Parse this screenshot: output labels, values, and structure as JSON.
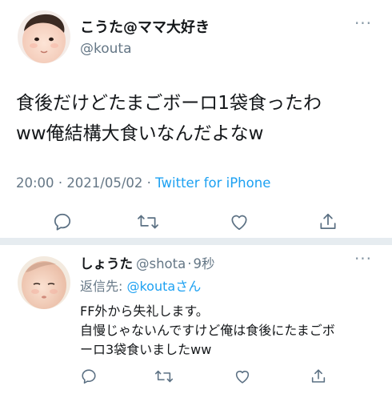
{
  "main_tweet": {
    "display_name": "こうた@ママ大好き",
    "handle": "@kouta",
    "body_lines": [
      "食後だけどたまごボーロ1袋食ったわ",
      "ww俺結構大食いなんだよなw"
    ],
    "time": "20:00",
    "separator": "·",
    "date": "2021/05/02",
    "source": "Twitter for iPhone",
    "more_label": "···"
  },
  "reply_tweet": {
    "display_name": "しょうた",
    "handle": "@shota",
    "time_ago": "9秒",
    "separator": "·",
    "reply_to_prefix": "返信先: ",
    "reply_to_mention": "@kouta",
    "reply_to_suffix": "さん",
    "body_lines": [
      "FF外から失礼します。",
      "自慢じゃないんですけど俺は食後にたまごボ",
      "ーロ3袋食いましたww"
    ],
    "more_label": "···"
  },
  "icons": {
    "reply": "reply-icon",
    "retweet": "retweet-icon",
    "like": "heart-icon",
    "share": "share-icon",
    "more": "more-icon"
  },
  "colors": {
    "text": "#14171a",
    "secondary": "#657786",
    "accent": "#1da1f2",
    "icon": "#5b7083",
    "divider": "#e6ecf0"
  }
}
